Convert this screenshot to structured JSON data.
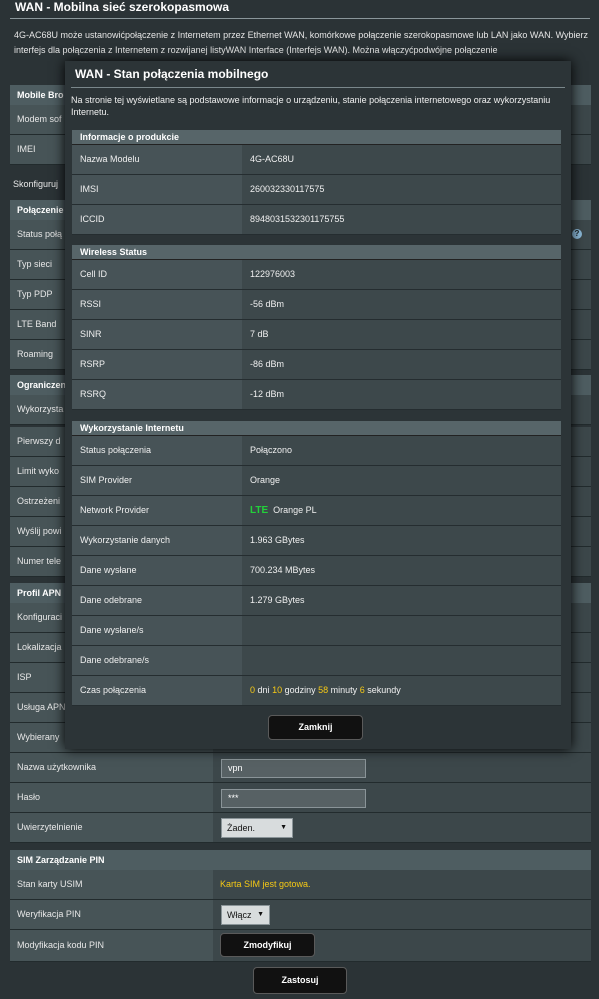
{
  "page": {
    "title": "WAN - Mobilna sieć szerokopasmowa",
    "intro": "4G-AC68U może ustanowićpołączenie z Internetem przez Ethernet WAN, komórkowe połączenie szerokopasmowe lub LAN jako WAN. Wybierz interfejs dla połączenia z Internetem z rozwijanej listyWAN Interface (Interfejs WAN). Można włączyćpodwójne połączenie"
  },
  "background": {
    "mobile_section": "Mobile Bro",
    "modem_label": "Modem sof",
    "imei_label": "IMEI",
    "configure_text": "Skonfiguruj",
    "connection_section": "Połączenie",
    "status_label": "Status połą",
    "network_type_label": "Typ sieci",
    "pdp_type_label": "Typ PDP",
    "lte_band_label": "LTE Band",
    "roaming_label": "Roaming",
    "limits_section": "Ograniczen",
    "usage_label": "Wykorzysta",
    "first_day_label": "Pierwszy d",
    "limit_label": "Limit wyko",
    "warning_label": "Ostrzeżeni",
    "send_label": "Wyślij powi",
    "number_label": "Numer tele",
    "apn_section": "Profil APN",
    "config_label": "Konfiguraci",
    "location_label": "Lokalizacja",
    "isp_label": "ISP",
    "apn_service_label": "Usługa APN",
    "dial_label": "Wybierany",
    "username_label": "Nazwa użytkownika",
    "username_value": "vpn",
    "password_label": "Hasło",
    "password_value": "***",
    "auth_label": "Uwierzytelnienie",
    "auth_value": "Żaden.",
    "sim_section": "SIM Zarządzanie PIN",
    "usim_label": "Stan karty USIM",
    "usim_value": "Karta SIM jest gotowa.",
    "pin_verify_label": "Weryfikacja PIN",
    "pin_verify_value": "Włącz",
    "pin_modify_label": "Modyfikacja kodu PIN",
    "modify_button": "Zmodyfikuj",
    "apply_button": "Zastosuj"
  },
  "modal": {
    "title": "WAN - Stan połączenia mobilnego",
    "description": "Na stronie tej wyświetlane są podstawowe informacje o urządzeniu, stanie połączenia internetowego oraz wykorzystaniu Internetu.",
    "product_section": "Informacje o produkcie",
    "model_label": "Nazwa Modelu",
    "model_value": "4G-AC68U",
    "imsi_label": "IMSI",
    "imsi_value": "260032330117575",
    "iccid_label": "ICCID",
    "iccid_value": "8948031532301175755",
    "wireless_section": "Wireless Status",
    "cell_label": "Cell ID",
    "cell_value": "122976003",
    "rssi_label": "RSSI",
    "rssi_value": "-56 dBm",
    "sinr_label": "SINR",
    "sinr_value": "7 dB",
    "rsrp_label": "RSRP",
    "rsrp_value": "-86 dBm",
    "rsrq_label": "RSRQ",
    "rsrq_value": "-12 dBm",
    "internet_section": "Wykorzystanie Internetu",
    "conn_status_label": "Status połączenia",
    "conn_status_value": "Połączono",
    "sim_provider_label": "SIM Provider",
    "sim_provider_value": "Orange",
    "network_provider_label": "Network Provider",
    "network_tech": "LTE",
    "network_provider_value": "Orange PL",
    "data_usage_label": "Wykorzystanie danych",
    "data_usage_value": "1.963 GBytes",
    "sent_label": "Dane wysłane",
    "sent_value": "700.234 MBytes",
    "received_label": "Dane odebrane",
    "received_value": "1.279 GBytes",
    "sent_rate_label": "Dane wysłane/s",
    "received_rate_label": "Dane odebrane/s",
    "time_label": "Czas połączenia",
    "time_days": "0",
    "time_days_unit": "dni",
    "time_hours": "10",
    "time_hours_unit": "godziny",
    "time_minutes": "58",
    "time_minutes_unit": "minuty",
    "time_seconds": "6",
    "time_seconds_unit": "sekundy",
    "close_button": "Zamknij"
  },
  "colors": {
    "accent_yellow": "#f6c915",
    "lte_green": "#22d13a"
  }
}
